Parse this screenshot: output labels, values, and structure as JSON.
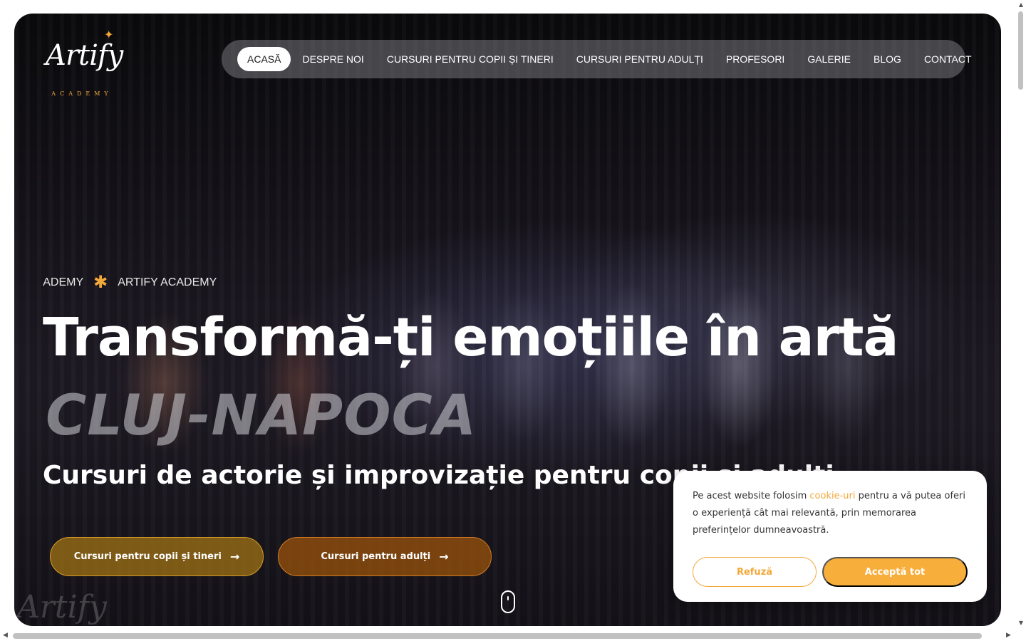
{
  "brand": {
    "logo_text": "Artify",
    "logo_subtitle": "ACADEMY"
  },
  "nav": {
    "items": [
      {
        "label": "ACASĂ",
        "active": true
      },
      {
        "label": "DESPRE NOI"
      },
      {
        "label": "CURSURI PENTRU COPII ȘI TINERI"
      },
      {
        "label": "CURSURI PENTRU ADULȚI"
      },
      {
        "label": "PROFESORI"
      },
      {
        "label": "GALERIE"
      },
      {
        "label": "BLOG"
      },
      {
        "label": "CONTACT"
      }
    ]
  },
  "hero": {
    "marquee": [
      "ACADEMY",
      "ARTIFY ACADEMY"
    ],
    "headline": "Transformă-ți emoțiile în artă",
    "city": "CLUJ-NAPOCA",
    "subline": "Cursuri de actorie și improvizație pentru copii și adulți",
    "buttons": {
      "kids": "Cursuri pentru copii și tineri",
      "adults": "Cursuri pentru adulți"
    }
  },
  "cookie": {
    "text_before": "Pe acest website folosim ",
    "link": "cookie-uri",
    "text_after": " pentru a vă putea oferi o experiență cât mai relevantă, prin memorarea preferințelor dumneavoastră.",
    "refuse": "Refuză",
    "accept": "Acceptă tot"
  },
  "colors": {
    "accent": "#f3a93a",
    "kids_button": "#a5761f",
    "adults_button": "#a0550a"
  }
}
